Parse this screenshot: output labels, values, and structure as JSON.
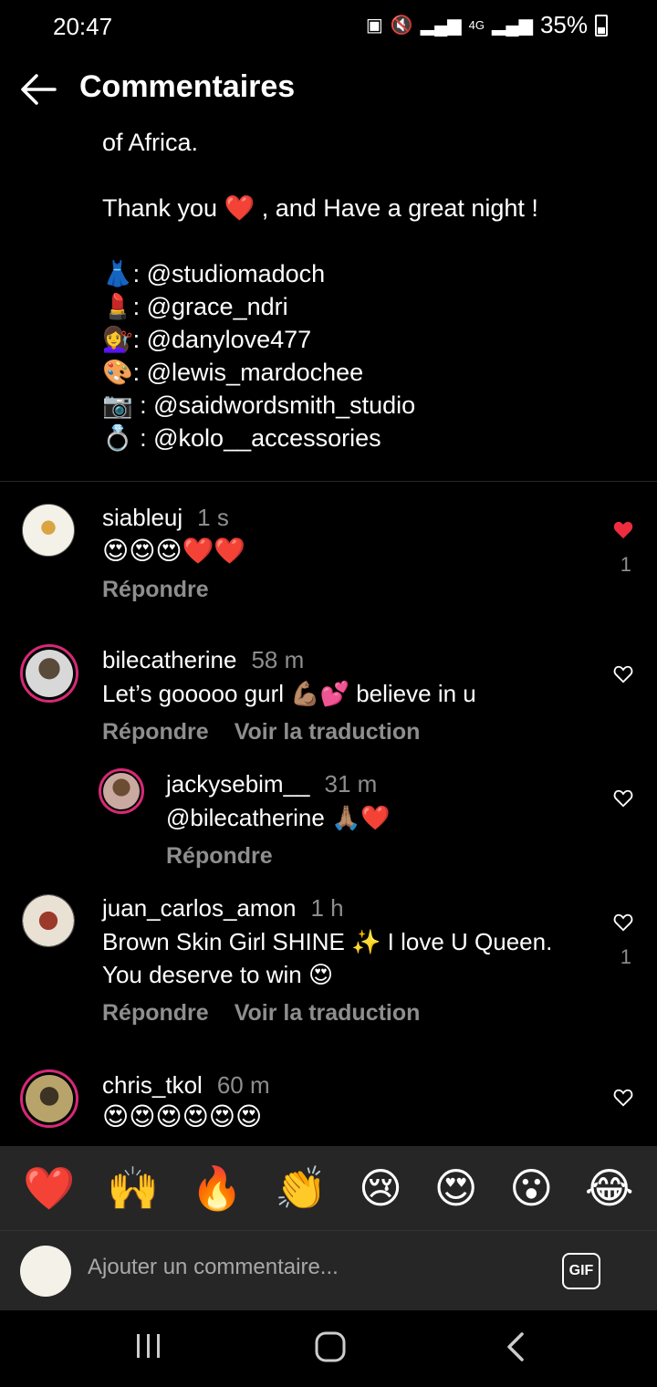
{
  "status": {
    "time": "20:47",
    "battery": "35%",
    "net": "4G"
  },
  "header": {
    "title": "Commentaires"
  },
  "caption": {
    "line1": "of Africa.",
    "thanks_before": "Thank you ",
    "thanks_heart": "❤️",
    "thanks_after": " , and Have a great night !",
    "credits": [
      {
        "emoji": "👗",
        "text": ": @studiomadoch"
      },
      {
        "emoji": "💄",
        "text": ": @grace_ndri"
      },
      {
        "emoji": "💇‍♀️",
        "text": ": @danylove477"
      },
      {
        "emoji": "🎨",
        "text": ": @lewis_mardochee"
      },
      {
        "emoji": "📷",
        "text": " : @saidwordsmith_studio"
      },
      {
        "emoji": "💍",
        "text": " : @kolo__accessories"
      }
    ]
  },
  "comments": [
    {
      "user": "siableuj",
      "time": "1 s",
      "text": "😍😍😍❤️❤️",
      "reply": "Répondre",
      "likes": "1",
      "liked": true
    },
    {
      "user": "bilecatherine",
      "time": "58 m",
      "text": "Let’s gooooo gurl 💪🏽💕 believe in u",
      "reply": "Répondre",
      "translate": "Voir la traduction"
    },
    {
      "user": "jackysebim__",
      "time": "31 m",
      "text": "@bilecatherine 🙏🏽❤️",
      "reply": "Répondre"
    },
    {
      "user": "juan_carlos_amon",
      "time": "1 h",
      "text1": "Brown Skin Girl SHINE ✨ I love U Queen.",
      "text2": "You deserve to win 😍",
      "reply": "Répondre",
      "translate": "Voir la traduction",
      "likes": "1"
    },
    {
      "user": "chris_tkol",
      "time": "60 m",
      "text": "😍😍😍😍😍😍"
    }
  ],
  "reactions": [
    "❤️",
    "🙌",
    "🔥",
    "👏",
    "😢",
    "😍",
    "😮",
    "😂"
  ],
  "input": {
    "placeholder": "Ajouter un commentaire...",
    "gif_label": "GIF"
  },
  "colors": {
    "background": "#000000",
    "like_red": "#ed2d3f",
    "muted": "#8e8e8e",
    "bar": "#262626"
  }
}
